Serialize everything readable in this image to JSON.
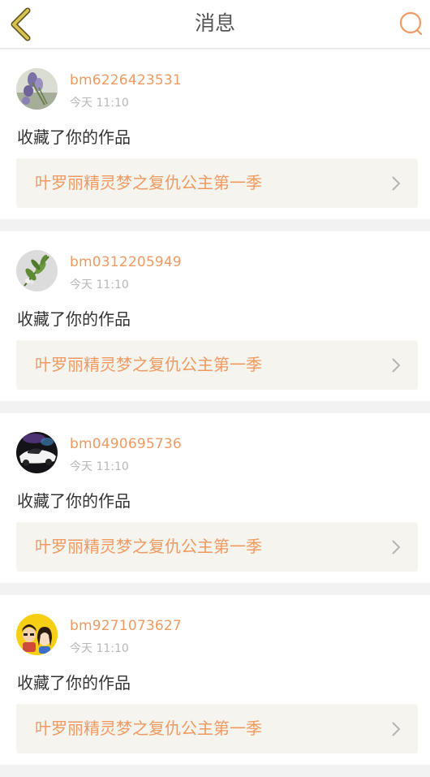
{
  "header": {
    "title": "消息",
    "back_icon": "chevron-left-icon",
    "search_icon": "search-icon"
  },
  "colors": {
    "accent": "#ef9a62",
    "back_arrow": "#c8b44a",
    "card_link_bg": "#f5f4ee"
  },
  "messages": [
    {
      "username": "bm6226423531",
      "time": "今天 11:10",
      "action": "收藏了你的作品",
      "work_title": "叶罗丽精灵梦之复仇公主第一季",
      "avatar": "lavender-flowers"
    },
    {
      "username": "bm0312205949",
      "time": "今天 11:10",
      "action": "收藏了你的作品",
      "work_title": "叶罗丽精灵梦之复仇公主第一季",
      "avatar": "green-leaf"
    },
    {
      "username": "bm0490695736",
      "time": "今天 11:10",
      "action": "收藏了你的作品",
      "work_title": "叶罗丽精灵梦之复仇公主第一季",
      "avatar": "white-sports-car"
    },
    {
      "username": "bm9271073627",
      "time": "今天 11:10",
      "action": "收藏了你的作品",
      "work_title": "叶罗丽精灵梦之复仇公主第一季",
      "avatar": "cartoon-couple"
    }
  ]
}
